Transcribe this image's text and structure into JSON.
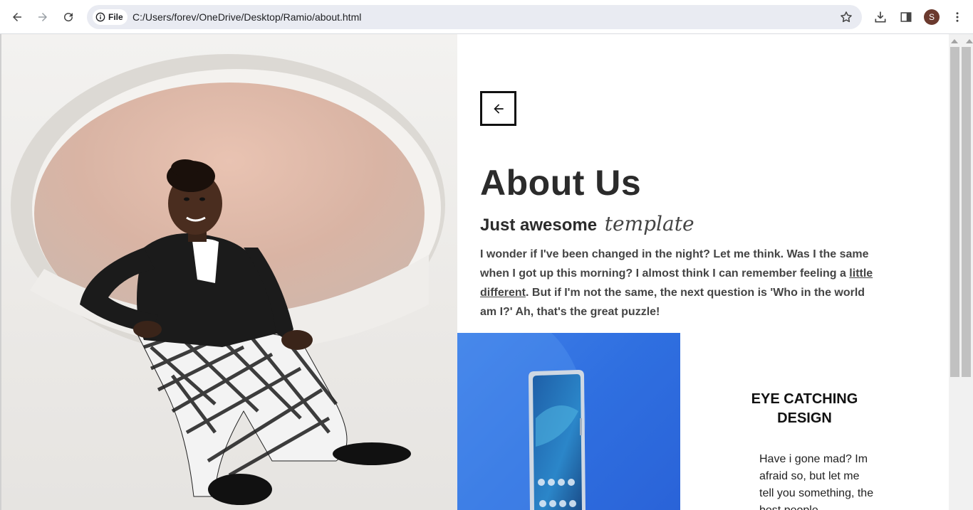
{
  "browser": {
    "site_chip_label": "File",
    "url": "C:/Users/forev/OneDrive/Desktop/Ramio/about.html",
    "profile_initial": "S",
    "icons": [
      "back-icon",
      "forward-icon",
      "reload-icon",
      "info-icon",
      "star-icon",
      "download-icon",
      "side-panel-icon",
      "menu-icon"
    ]
  },
  "page": {
    "title": "About Us",
    "subtitle_main": "Just awesome",
    "subtitle_script": "template",
    "paragraph_before": "I wonder if I've been changed in the night? Let me think. Was I the same when I got up this morning? I almost think I can remember feeling a ",
    "paragraph_link": "little different",
    "paragraph_after": ". But if I'm not the same, the next question is 'Who in the world am I?' Ah, that's the great puzzle!",
    "feature_title": "EYE CATCHING DESIGN",
    "feature_text": "Have i gone mad? Im afraid so, but let me tell you something, the best people"
  },
  "colors": {
    "chrome_bg": "#ffffff",
    "omnibox_bg": "#e9ebf2",
    "avatar_bg": "#6b3a2e",
    "heading": "#2b2b2b",
    "phone_bg": "#2f6fe0"
  }
}
